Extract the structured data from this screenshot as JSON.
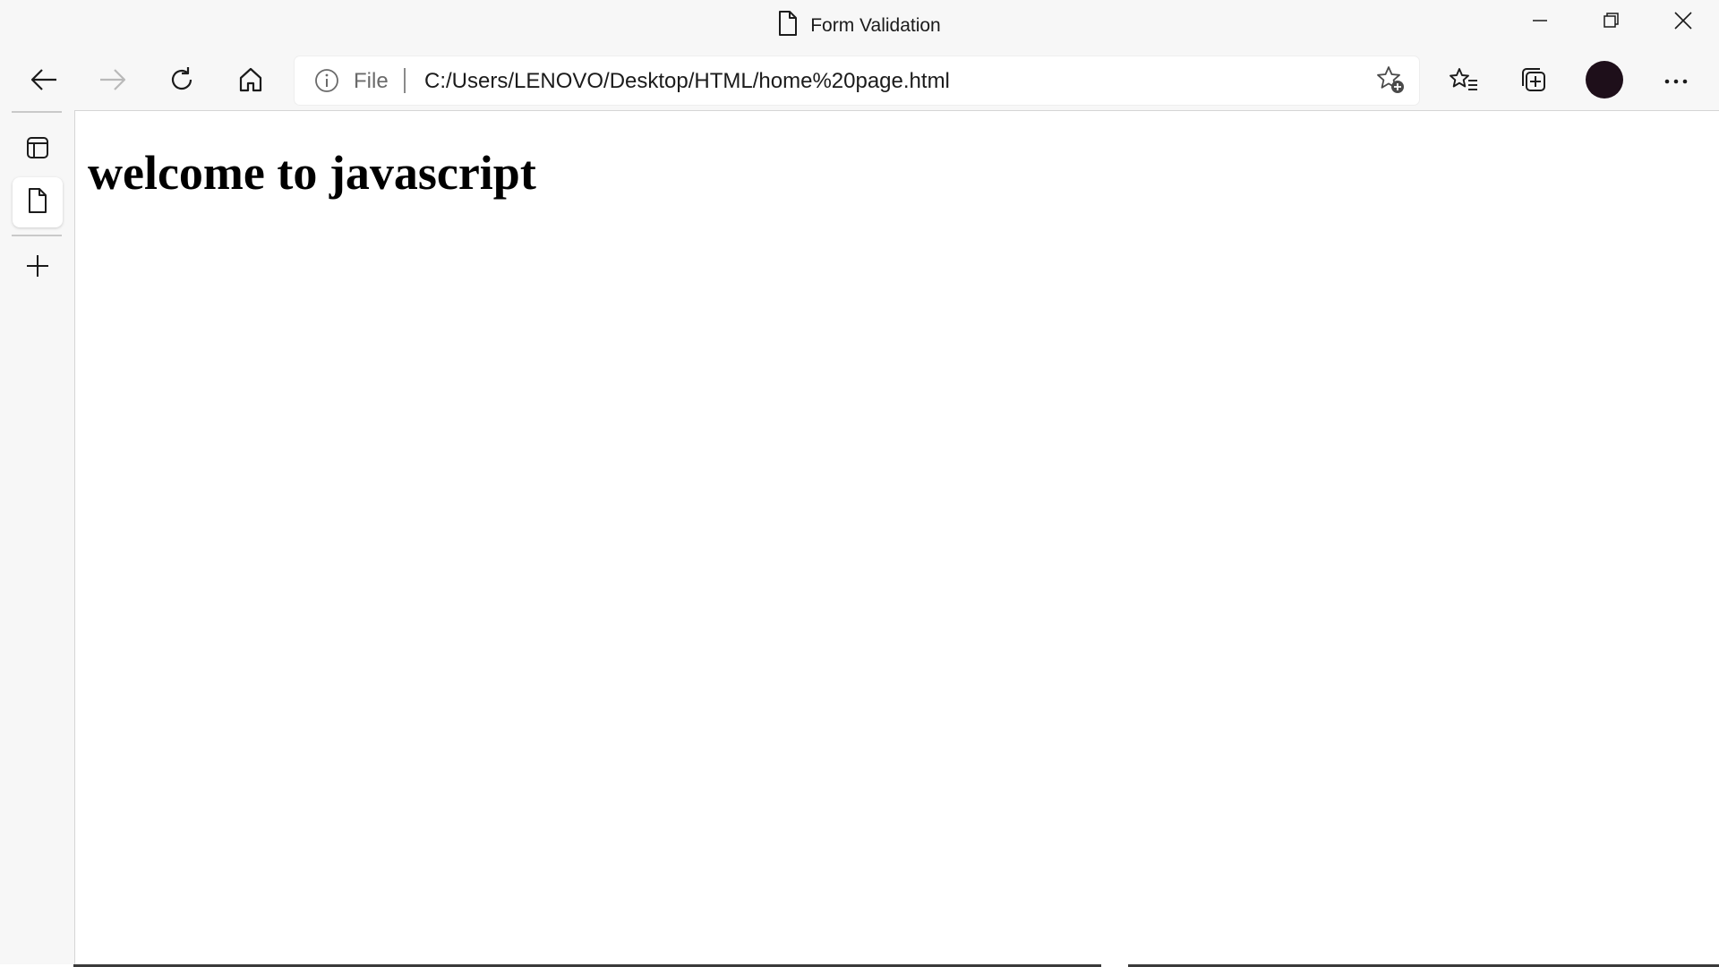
{
  "window": {
    "title": "Form Validation",
    "icons": {
      "page": "document-icon",
      "minimize": "minimize-icon",
      "maximize": "restore-icon",
      "close": "close-icon"
    }
  },
  "toolbar": {
    "back_icon": "back-arrow-icon",
    "forward_icon": "forward-arrow-icon",
    "refresh_icon": "refresh-icon",
    "home_icon": "home-icon",
    "favorites_icon": "favorites-icon",
    "collections_icon": "collections-icon",
    "more_icon": "more-icon"
  },
  "address_bar": {
    "scheme_label": "File",
    "url": "C:/Users/LENOVO/Desktop/HTML/home%20page.html",
    "info_icon": "info-icon",
    "add_favorite_icon": "add-favorite-icon"
  },
  "sidebar": {
    "items": [
      {
        "icon": "tab-actions-icon"
      },
      {
        "icon": "document-tab-icon",
        "active": true
      },
      {
        "icon": "new-tab-plus-icon"
      }
    ]
  },
  "page": {
    "heading": "welcome to javascript"
  },
  "colors": {
    "chrome_background": "#f7f7f7",
    "content_background": "#ffffff",
    "avatar": "#1e0f1a",
    "text": "#1b1b1b"
  }
}
